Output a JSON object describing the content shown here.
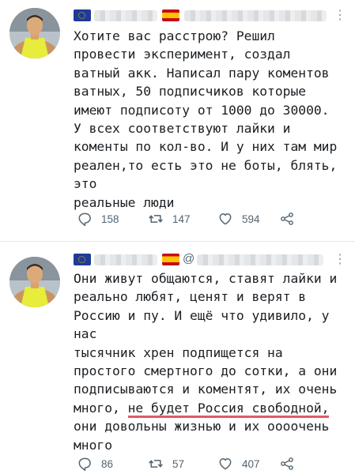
{
  "tweets": [
    {
      "text": "Хотите вас расстрою? Решил\nпровести эксперимент, создал\nватный акк. Написал пару коментов\nватных, 50 подписчиков которые\nимеют подписоту от 1000 до 30000.\nУ всех соответствуют лайки и\nкоменты по кол-во. И у них там мир\nреален,то есть это не боты, блять, это\nреальные люди",
      "stats": {
        "replies": "158",
        "retweets": "147",
        "likes": "594"
      }
    },
    {
      "handle_at": "@",
      "text_before": "Они живут общаются, ставят лайки и\nреально любят, ценят и верят в\nРоссию и пу. И ещё что удивило, у нас\nтысячник хрен подпищется на\nпростого смертного до сотки, а они\nподписываются и коментят, их очень\nмного, ",
      "text_underlined": "не будет Россия свободной,",
      "text_after": "\nони довольны жизнью и их оооочень\nмного",
      "stats": {
        "replies": "86",
        "retweets": "57",
        "likes": "407"
      }
    }
  ],
  "icons": {
    "reply": "reply-icon",
    "retweet": "retweet-icon",
    "like": "heart-icon",
    "share": "share-icon",
    "more": "more-icon"
  },
  "colors": {
    "underline": "#e05a6a",
    "muted": "#536471",
    "eu_flag": "#1f3b9a",
    "es_red": "#c60b1e",
    "es_yellow": "#ffc400"
  }
}
